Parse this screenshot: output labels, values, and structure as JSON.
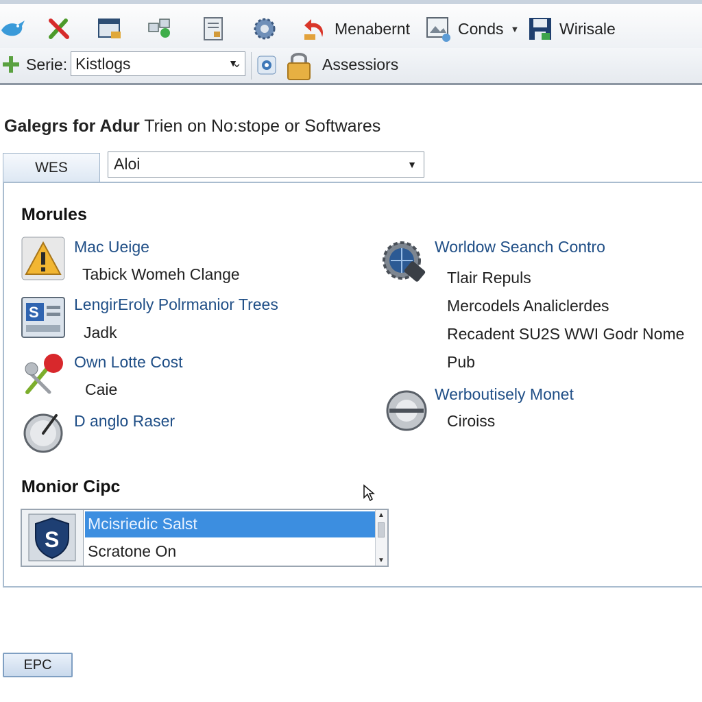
{
  "toolbar": {
    "icons": [
      "bird-icon",
      "red-x-icon",
      "window-icon",
      "network-icon",
      "document-icon",
      "gear-icon",
      "undo-arrow-icon",
      "image-icon",
      "save-icon"
    ],
    "menabernt_label": "Menabernt",
    "conds_label": "Conds",
    "wirisale_label": "Wirisale"
  },
  "toolbar2": {
    "serie_label": "Serie:",
    "serie_value": "Kistlogs",
    "assessors_label": "Assessiors"
  },
  "page": {
    "heading_bold": "Galegrs for Adur",
    "heading_rest": " Trien on No:stope or Softwares"
  },
  "tab": {
    "label": "WES"
  },
  "main_select": {
    "value": "Aloi"
  },
  "modules": {
    "title": "Morules",
    "left": [
      {
        "icon": "warning-icon",
        "link": "Mac Ueige",
        "sub": "Tabick Womeh Clange"
      },
      {
        "icon": "s-app-icon",
        "link": "LengirEroly Polrmanior Trees",
        "sub": "Jadk"
      },
      {
        "icon": "pin-tool-icon",
        "link": "Own Lotte Cost",
        "sub": "Caie"
      },
      {
        "icon": "gauge-icon",
        "link": "D anglo Raser",
        "sub": ""
      }
    ],
    "right": [
      {
        "icon": "globe-gear-icon",
        "link": "Worldow Seanch Contro",
        "subs": [
          "Tlair Repuls",
          "Mercodels Analiclerdes",
          "Recadent SU2S WWI Godr Nome",
          "Pub"
        ]
      },
      {
        "icon": "disc-icon",
        "link": "Werboutisely Monet",
        "subs": [
          "Ciroiss"
        ]
      }
    ]
  },
  "monitor": {
    "title": "Monior Cipc",
    "items": [
      "Mcisriedic Salst",
      "Scratone On"
    ],
    "selected_index": 0
  },
  "footer": {
    "button_label": "EPC"
  },
  "colors": {
    "link": "#1f4e86",
    "selection": "#3c8ee0",
    "panel_border": "#a9bccf"
  }
}
